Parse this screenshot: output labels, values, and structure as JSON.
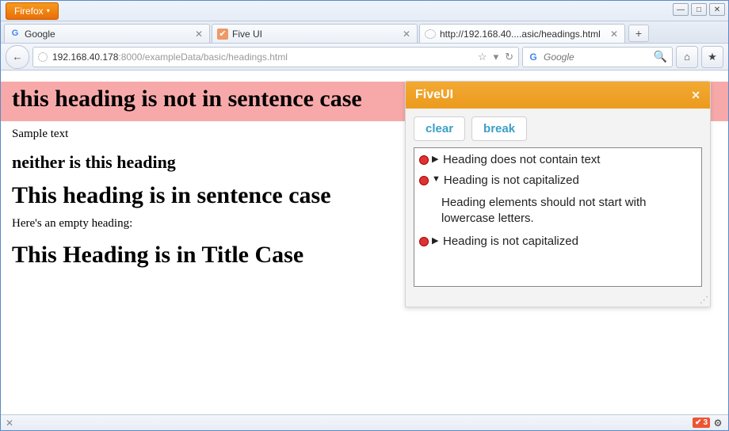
{
  "menu": {
    "firefox_label": "Firefox"
  },
  "window_controls": {
    "min": "—",
    "max": "□",
    "close": "✕"
  },
  "tabs": [
    {
      "label": "Google",
      "favicon_html": "G",
      "active": false
    },
    {
      "label": "Five UI",
      "favicon_html": "✔",
      "active": false
    },
    {
      "label": "http://192.168.40....asic/headings.html",
      "favicon_html": "◌",
      "active": true
    }
  ],
  "nav": {
    "back": "←",
    "url_host": "192.168.40.178",
    "url_port_path": ":8000/exampleData/basic/headings.html",
    "bookmark": "☆",
    "dropdown": "▾",
    "reload": "↻",
    "search_placeholder": "Google",
    "search_go": "🔍",
    "home": "⌂",
    "bookmarks_btn": "★"
  },
  "page": {
    "h1_1": "this heading is not in sentence case",
    "p1": "Sample text",
    "h2_1": "neither is this heading",
    "h1_2": "This heading is in sentence case",
    "p2": "Here's an empty heading:",
    "h1_3": "This Heading is in Title Case"
  },
  "fiveui": {
    "title": "FiveUI",
    "clear": "clear",
    "break": "break",
    "items": [
      {
        "expanded": false,
        "msg": "Heading does not contain text"
      },
      {
        "expanded": true,
        "msg": "Heading is not capitalized",
        "detail": "Heading elements should not start with lowercase letters."
      },
      {
        "expanded": false,
        "msg": "Heading is not capitalized"
      }
    ]
  },
  "status": {
    "x": "✕",
    "badge_icon": "✔",
    "badge_count": "3",
    "gear": "⚙"
  }
}
